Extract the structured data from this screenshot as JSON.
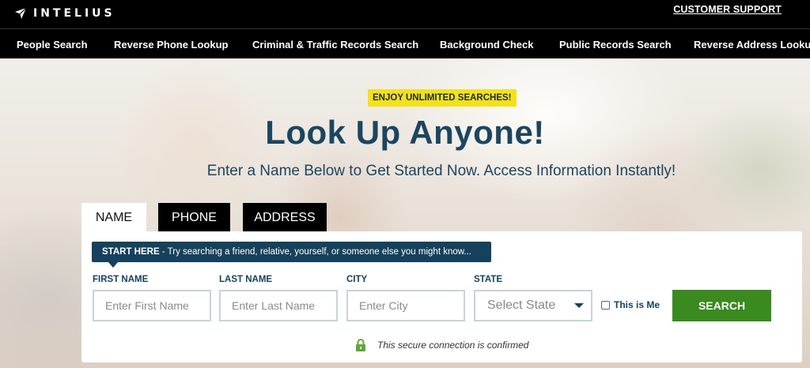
{
  "header": {
    "brand": "INTELIUS",
    "support_link": "CUSTOMER SUPPORT"
  },
  "nav": {
    "items": [
      {
        "label": "People Search"
      },
      {
        "label": "Reverse Phone Lookup"
      },
      {
        "label": "Criminal & Traffic Records Search"
      },
      {
        "label": "Background Check"
      },
      {
        "label": "Public Records Search"
      },
      {
        "label": "Reverse Address Lookup"
      }
    ]
  },
  "hero": {
    "badge": "ENJOY UNLIMITED SEARCHES!",
    "title": "Look Up Anyone!",
    "subtitle": "Enter a Name Below to Get Started Now. Access Information Instantly!"
  },
  "tabs": [
    {
      "label": "NAME",
      "active": true
    },
    {
      "label": "PHONE",
      "active": false
    },
    {
      "label": "ADDRESS",
      "active": false
    }
  ],
  "form": {
    "tip_strong": "START HERE",
    "tip_text": " - Try searching a friend, relative, yourself, or someone else you might know...",
    "first_name": {
      "label": "FIRST NAME",
      "placeholder": "Enter First Name",
      "value": ""
    },
    "last_name": {
      "label": "LAST NAME",
      "placeholder": "Enter Last Name",
      "value": ""
    },
    "city": {
      "label": "CITY",
      "placeholder": "Enter City",
      "value": ""
    },
    "state": {
      "label": "STATE",
      "selected": "Select State"
    },
    "this_is_me": {
      "label": "This is Me",
      "checked": false
    },
    "search_button": "SEARCH",
    "secure_text": "This secure connection is confirmed"
  },
  "colors": {
    "navy": "#16415c",
    "headline": "#1c4560",
    "badge": "#f3e11c",
    "search_green": "#3a8a1f",
    "input_border": "#c3d6d8"
  }
}
